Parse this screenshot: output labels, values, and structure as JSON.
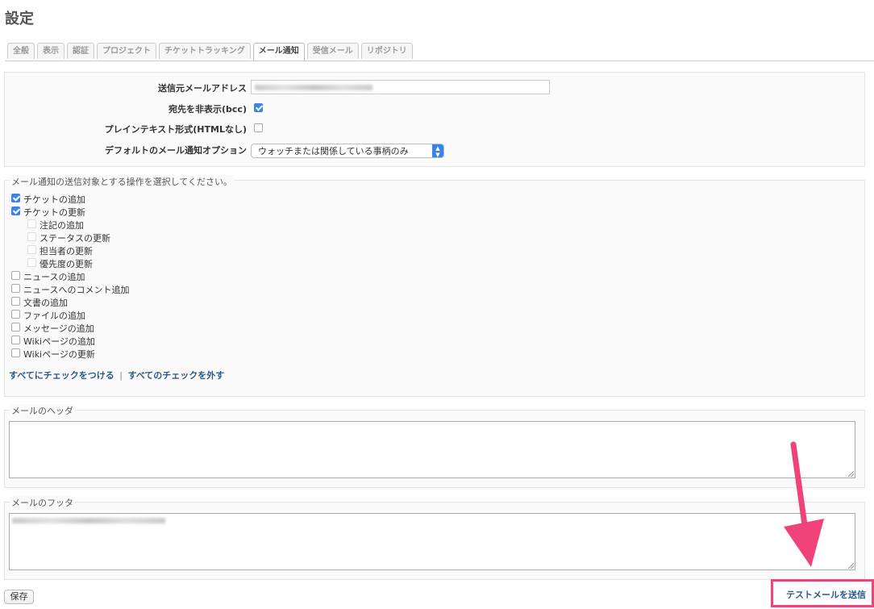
{
  "page": {
    "title": "設定"
  },
  "tabs": [
    {
      "label": "全般"
    },
    {
      "label": "表示"
    },
    {
      "label": "認証"
    },
    {
      "label": "プロジェクト"
    },
    {
      "label": "チケットトラッキング"
    },
    {
      "label": "メール通知",
      "active": true
    },
    {
      "label": "受信メール"
    },
    {
      "label": "リポジトリ"
    }
  ],
  "general": {
    "from_label": "送信元メールアドレス",
    "bcc_label": "宛先を非表示(bcc)",
    "bcc_checked": true,
    "plain_label": "プレインテキスト形式(HTMLなし)",
    "plain_checked": false,
    "default_option_label": "デフォルトのメール通知オプション",
    "default_option_value": "ウォッチまたは関係している事柄のみ"
  },
  "notify": {
    "legend": "メール通知の送信対象とする操作を選択してください。",
    "items": [
      {
        "label": "チケットの追加",
        "checked": true,
        "indent": false
      },
      {
        "label": "チケットの更新",
        "checked": true,
        "indent": false
      },
      {
        "label": "注記の追加",
        "checked": false,
        "indent": true
      },
      {
        "label": "ステータスの更新",
        "checked": false,
        "indent": true
      },
      {
        "label": "担当者の更新",
        "checked": false,
        "indent": true
      },
      {
        "label": "優先度の更新",
        "checked": false,
        "indent": true
      },
      {
        "label": "ニュースの追加",
        "checked": false,
        "indent": false
      },
      {
        "label": "ニュースへのコメント追加",
        "checked": false,
        "indent": false
      },
      {
        "label": "文書の追加",
        "checked": false,
        "indent": false
      },
      {
        "label": "ファイルの追加",
        "checked": false,
        "indent": false
      },
      {
        "label": "メッセージの追加",
        "checked": false,
        "indent": false
      },
      {
        "label": "Wikiページの追加",
        "checked": false,
        "indent": false
      },
      {
        "label": "Wikiページの更新",
        "checked": false,
        "indent": false
      }
    ],
    "check_all": "すべてにチェックをつける",
    "separator": "|",
    "uncheck_all": "すべてのチェックを外す"
  },
  "header_section": {
    "legend": "メールのヘッダ"
  },
  "footer_section": {
    "legend": "メールのフッタ"
  },
  "actions": {
    "save": "保存",
    "test_mail": "テストメールを送信"
  },
  "colors": {
    "highlight": "#f0437a",
    "link": "#2a5a8a",
    "checkbox_on": "#3d85e0"
  }
}
